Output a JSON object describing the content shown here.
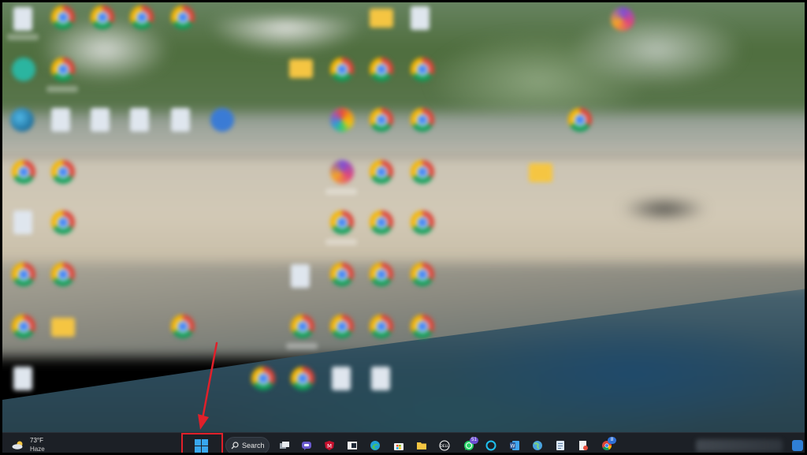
{
  "screen": {
    "title": "Windows 11 desktop with blurred icons"
  },
  "weather": {
    "temperature": "73°F",
    "condition": "Haze",
    "icon": "cloud-sun-icon"
  },
  "taskbar": {
    "start": {
      "icon": "windows-start-icon",
      "highlighted": true,
      "highlight_color": "#e0202a"
    },
    "search": {
      "label": "Search",
      "icon": "search-icon"
    },
    "pinned": [
      {
        "name": "task-view",
        "icon": "task-view-icon",
        "color": "#d0d4da"
      },
      {
        "name": "teams-chat",
        "icon": "teams-chat-icon",
        "color": "#6a5acd"
      },
      {
        "name": "mcafee",
        "icon": "mcafee-icon",
        "color": "#c8102e"
      },
      {
        "name": "widgets-app",
        "icon": "window-icon",
        "color": "#e6e6e6"
      },
      {
        "name": "edge",
        "icon": "edge-icon",
        "color": "#1fa0d8"
      },
      {
        "name": "microsoft-store",
        "icon": "store-icon",
        "color": "#f2f2f2"
      },
      {
        "name": "file-explorer",
        "icon": "folder-icon",
        "color": "#f5c542"
      },
      {
        "name": "dell",
        "icon": "dell-icon",
        "color": "#ffffff"
      },
      {
        "name": "whatsapp",
        "icon": "whatsapp-icon",
        "color": "#25d366",
        "badge": "51"
      },
      {
        "name": "alexa",
        "icon": "alexa-icon",
        "color": "#1ec0ef"
      },
      {
        "name": "word",
        "icon": "word-icon",
        "color": "#2b5797"
      },
      {
        "name": "network-globe",
        "icon": "globe-icon",
        "color": "#4aa3df"
      },
      {
        "name": "notepad",
        "icon": "notepad-icon",
        "color": "#8fb3d9"
      },
      {
        "name": "snipping",
        "icon": "snip-icon",
        "color": "#e8e8e8"
      },
      {
        "name": "chrome",
        "icon": "chrome-icon",
        "color": "#4285f4",
        "badge": "8"
      }
    ]
  },
  "annotation": {
    "arrow_color": "#e0202a"
  }
}
